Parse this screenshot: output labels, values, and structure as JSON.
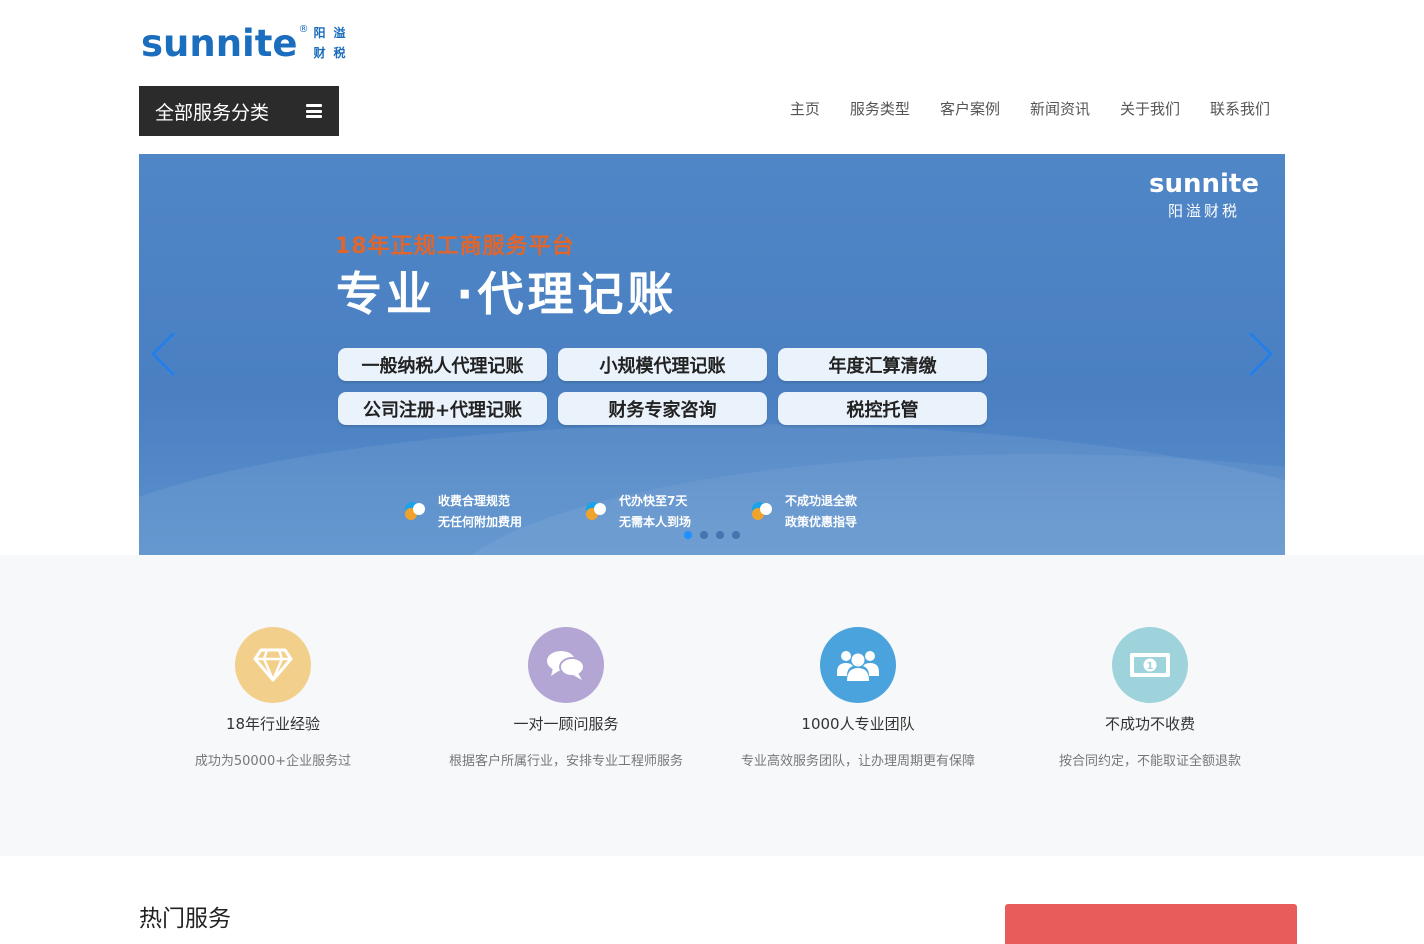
{
  "logo": {
    "word": "sunnite",
    "reg": "®",
    "cn_chars": [
      "阳",
      "溢",
      "财",
      "税"
    ]
  },
  "all_services": {
    "label": "全部服务分类"
  },
  "nav": [
    {
      "label": "主页"
    },
    {
      "label": "服务类型"
    },
    {
      "label": "客户案例"
    },
    {
      "label": "新闻资讯"
    },
    {
      "label": "关于我们"
    },
    {
      "label": "联系我们"
    }
  ],
  "banner": {
    "logo_word": "sunnite",
    "logo_cn": "阳溢财税",
    "tagline": "18年正规工商服务平台",
    "headline": "专业 ·代理记账",
    "pills": [
      "一般纳税人代理记账",
      "小规模代理记账",
      "年度汇算清缴",
      "公司注册+代理记账",
      "财务专家咨询",
      "税控托管"
    ],
    "features": [
      {
        "line1": "收费合理规范",
        "line2": "无任何附加费用"
      },
      {
        "line1": "代办快至7天",
        "line2": "无需本人到场"
      },
      {
        "line1": "不成功退全款",
        "line2": "政策优惠指导"
      }
    ],
    "active_slide": 1,
    "slide_count": 4
  },
  "advantages": [
    {
      "icon": "diamond-icon",
      "color": "#f2d08c",
      "title": "18年行业经验",
      "desc": "成功为50000+企业服务过"
    },
    {
      "icon": "chat-icon",
      "color": "#b4a6d4",
      "title": "一对一顾问服务",
      "desc": "根据客户所属行业，安排专业工程师服务"
    },
    {
      "icon": "team-icon",
      "color": "#4aa3dc",
      "title": "1000人专业团队",
      "desc": "专业高效服务团队，让办理周期更有保障"
    },
    {
      "icon": "money-icon",
      "color": "#9fd3dc",
      "title": "不成功不收费",
      "desc": "按合同约定，不能取证全额退款"
    }
  ],
  "hot": {
    "title": "热门服务"
  }
}
